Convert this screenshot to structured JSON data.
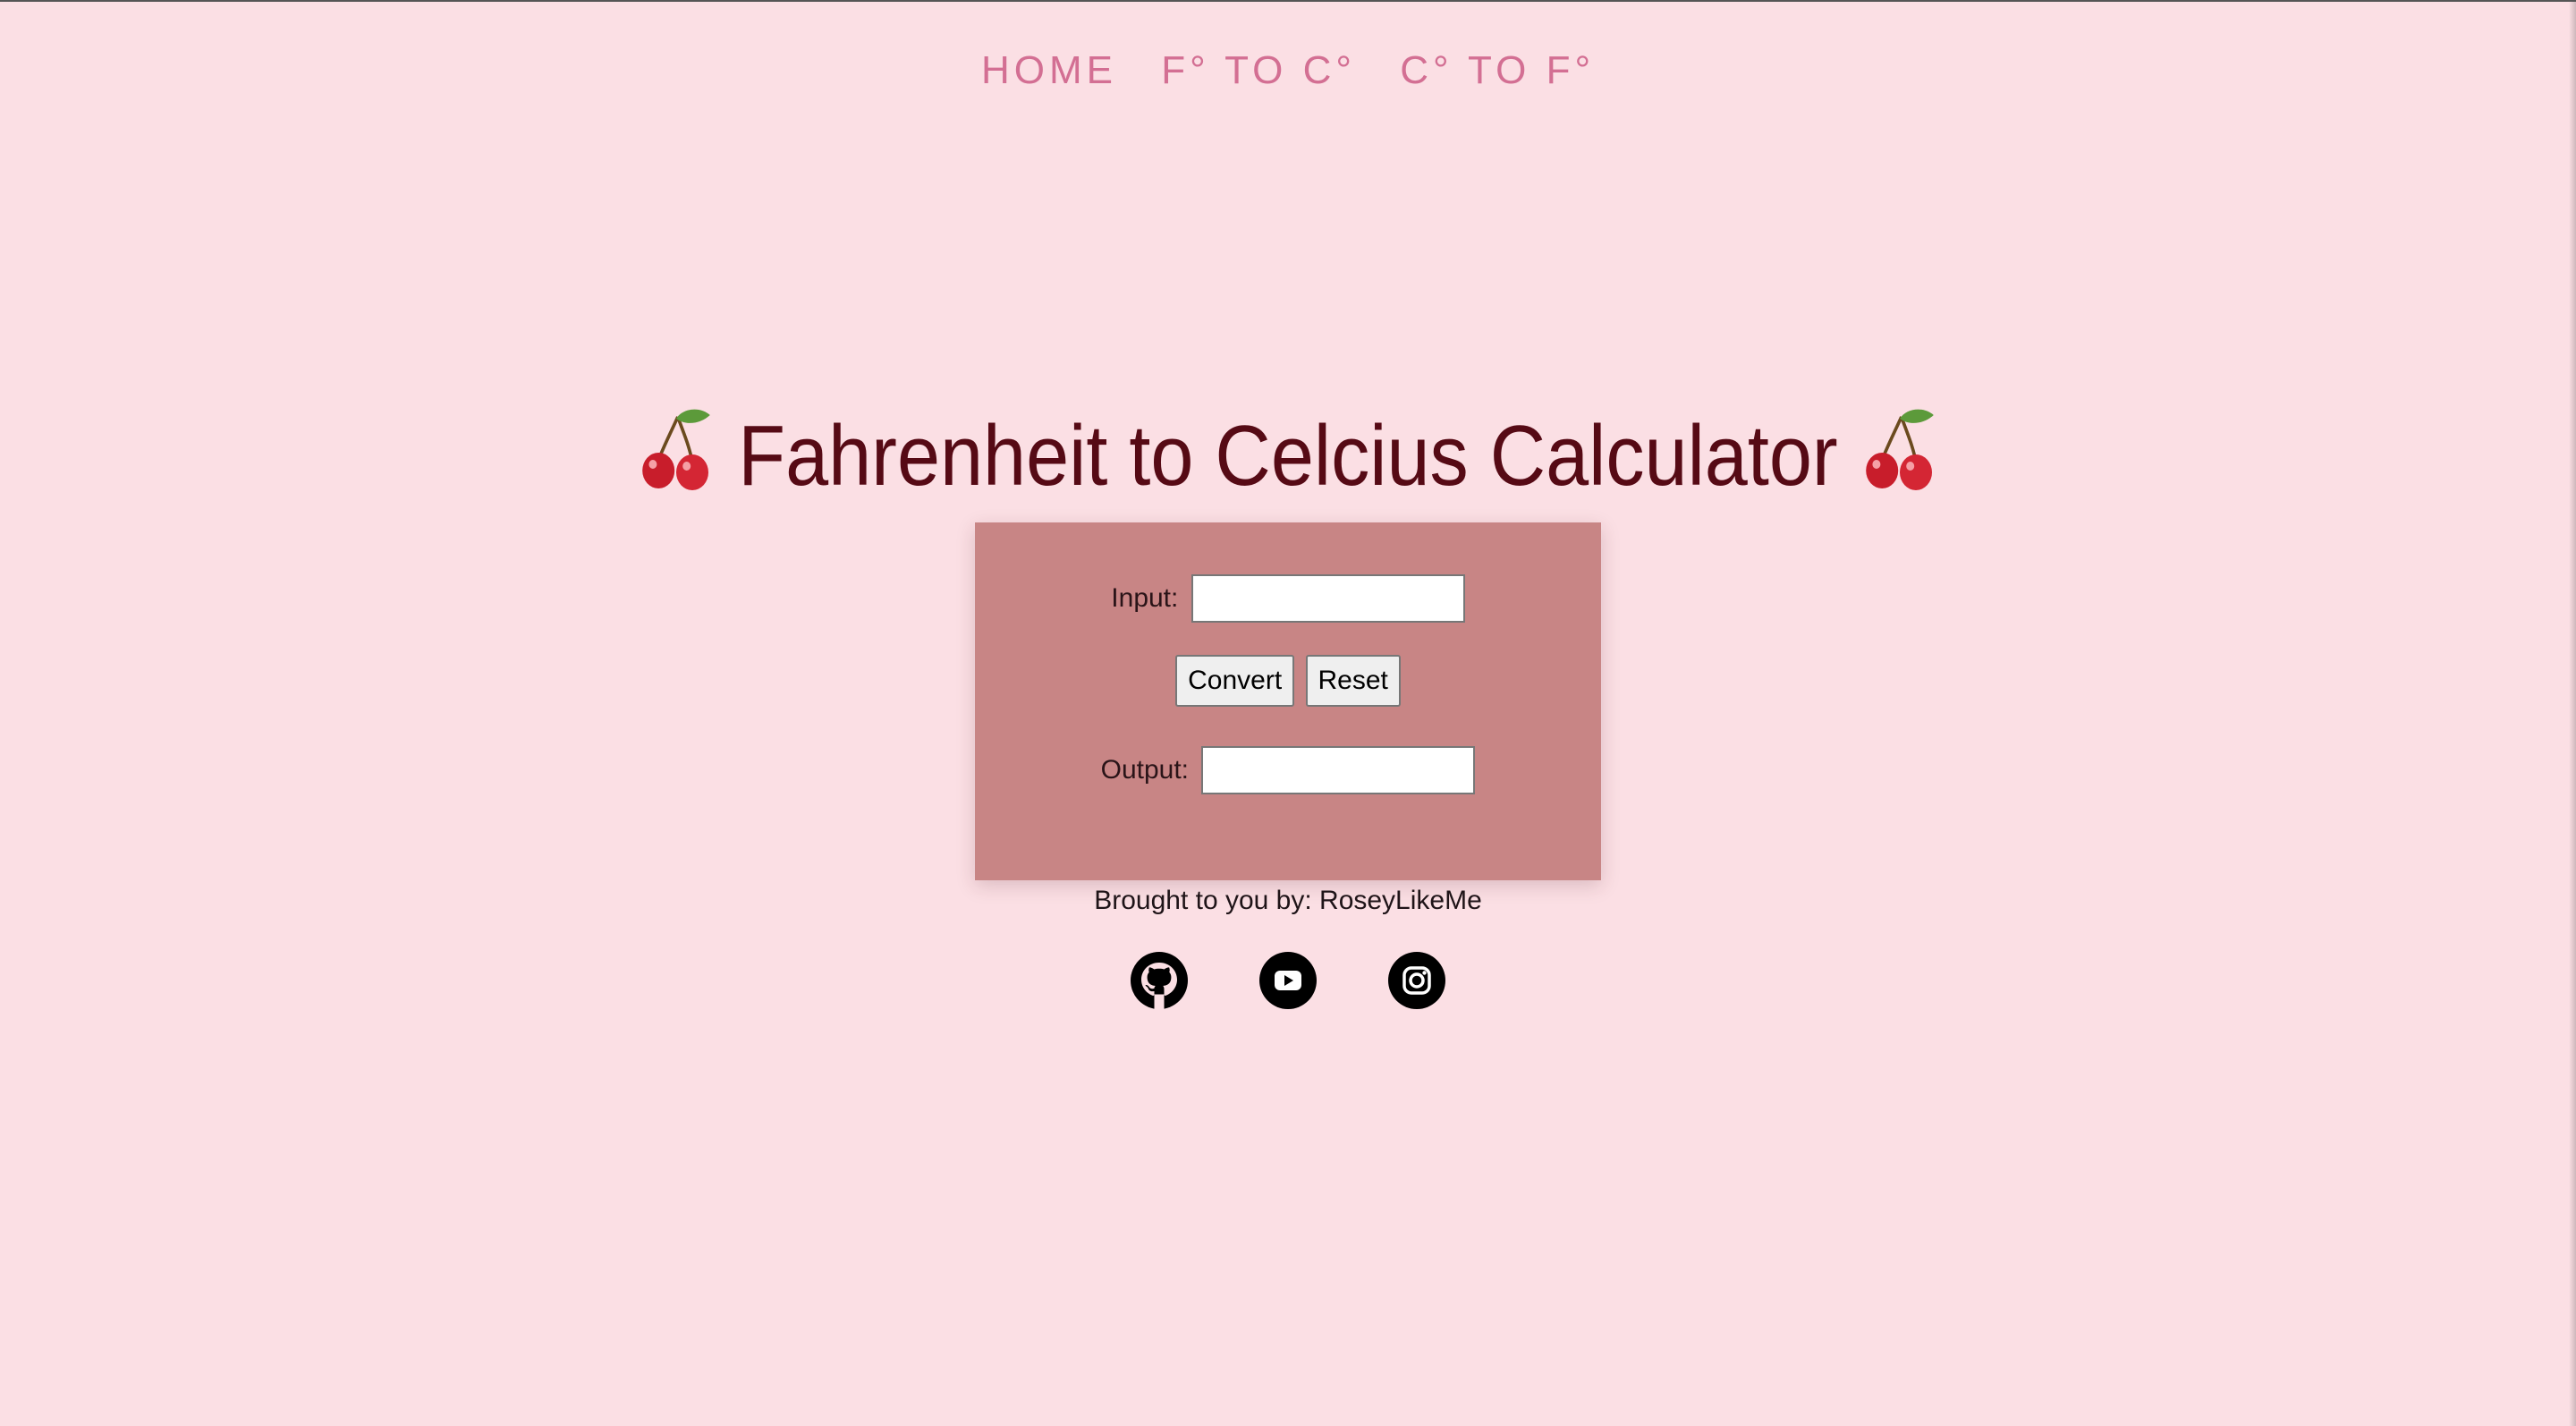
{
  "nav": {
    "items": [
      {
        "label": "HOME"
      },
      {
        "label": "F° TO C°"
      },
      {
        "label": "C° TO F°"
      }
    ]
  },
  "header": {
    "title": "Fahrenheit to Celcius Calculator",
    "emoji_icon": "cherry-icon"
  },
  "calculator": {
    "input_label": "Input:",
    "input_value": "",
    "convert_label": "Convert",
    "reset_label": "Reset",
    "output_label": "Output:",
    "output_value": ""
  },
  "footer": {
    "credit": "Brought to you by: RoseyLikeMe",
    "social": [
      {
        "icon": "github-icon"
      },
      {
        "icon": "youtube-icon"
      },
      {
        "icon": "instagram-icon"
      }
    ]
  },
  "colors": {
    "background": "#fbdfe4",
    "nav": "#d36f93",
    "title": "#560a15",
    "panel": "#c88585"
  }
}
